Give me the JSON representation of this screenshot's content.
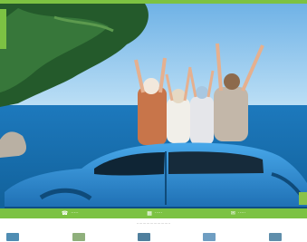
{
  "features": [
    {
      "label": "·····",
      "icon": "phone-icon"
    },
    {
      "label": "·····",
      "icon": "calendar-icon"
    },
    {
      "label": "·····",
      "icon": "chat-icon"
    }
  ],
  "headline": "····························",
  "colors": {
    "accent": "#7cc243",
    "car": "#2c8fd6",
    "sea": "#1b7cc0",
    "sky": "#8cc7ee"
  }
}
